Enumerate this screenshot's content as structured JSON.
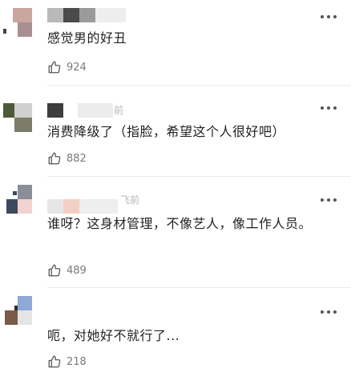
{
  "comments": [
    {
      "text": "感觉男的好丑",
      "time": "",
      "likes": "924",
      "avatar_colors": [
        "#c9a6a0",
        "#8f7f7f",
        "#a89090"
      ],
      "name_colors": [
        "#b9b9b9",
        "#4a4a4a",
        "#9a9a9a",
        "#d6d6d6"
      ]
    },
    {
      "text": "消费降级了（指脸，希望这个人很好吧）",
      "time": "前",
      "likes": "882",
      "avatar_colors": [
        "#4d5a38",
        "#cfcfcf",
        "#7c7c6a"
      ],
      "name_colors": [
        "#3d3d3d",
        "#e9e9e9"
      ]
    },
    {
      "text": "谁呀？这身材管理，不像艺人，像工作人员。",
      "time": "飞前",
      "likes": "489",
      "avatar_colors": [
        "#8a8e98",
        "#f0d2cf",
        "#3d4a5e"
      ],
      "name_colors": [
        "#e6e6e6",
        "#f4cfc4",
        "#e9e9e9"
      ]
    },
    {
      "text": "呃，对她好不就行了...",
      "time": "",
      "likes": "218",
      "avatar_colors": [
        "#8fa8d8",
        "#7a5a48",
        "#e4e4e4"
      ],
      "name_colors": []
    }
  ],
  "icons": {
    "more": "more-dots-icon",
    "like": "thumbs-up-icon"
  }
}
